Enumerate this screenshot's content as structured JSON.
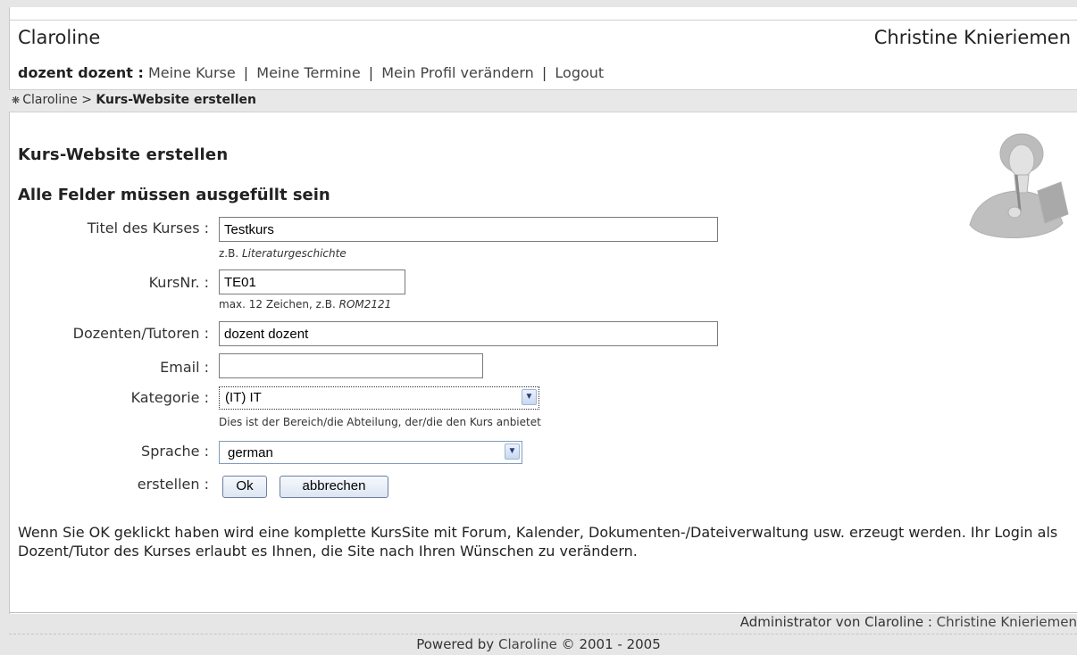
{
  "header": {
    "site_name": "Claroline",
    "user_name": "Christine Knieriemen"
  },
  "nav": {
    "who": "dozent dozent :",
    "links": [
      "Meine Kurse",
      "Meine Termine",
      "Mein Profil verändern",
      "Logout"
    ],
    "separator": "|"
  },
  "breadcrumb": {
    "home_icon": "house-icon",
    "root": "Claroline",
    "separator": ">",
    "current": "Kurs-Website erstellen"
  },
  "page": {
    "title": "Kurs-Website erstellen",
    "required_note": "Alle Felder müssen ausgefüllt sein",
    "mascot_icon": "claroline-mascot-icon"
  },
  "form": {
    "titel": {
      "label": "Titel des Kurses :",
      "value": "Testkurs",
      "hint_prefix": "z.B.",
      "hint_example": "Literaturgeschichte"
    },
    "kursnr": {
      "label": "KursNr. :",
      "value": "TE01",
      "hint_prefix": "max. 12 Zeichen, z.B.",
      "hint_example": "ROM2121"
    },
    "dozenten": {
      "label": "Dozenten/Tutoren :",
      "value": "dozent dozent"
    },
    "email": {
      "label": "Email :",
      "value": ""
    },
    "kategorie": {
      "label": "Kategorie :",
      "selected": "(IT) IT",
      "hint": "Dies ist der Bereich/die Abteilung, der/die den Kurs anbietet"
    },
    "sprache": {
      "label": "Sprache :",
      "selected": "german"
    },
    "erstellen": {
      "label": "erstellen :",
      "ok_label": "Ok",
      "cancel_label": "abbrechen"
    }
  },
  "description": "Wenn Sie OK geklickt haben wird eine komplette KursSite mit Forum, Kalender, Dokumenten-/Dateiverwaltung usw. erzeugt werden. Ihr Login als Dozent/Tutor des Kurses erlaubt es Ihnen, die Site nach Ihren Wünschen zu verändern.",
  "footer": {
    "admin_prefix": "Administrator von Claroline :",
    "admin_name": "Christine Knieriemen",
    "powered_prefix": "Powered by",
    "powered_link": "Claroline",
    "powered_suffix": "© 2001 - 2005"
  },
  "colors": {
    "page_bg": "#e6e6e6",
    "panel_bg": "#ffffff",
    "breadcrumb_bg": "#e8e8e8",
    "text": "#222222"
  }
}
